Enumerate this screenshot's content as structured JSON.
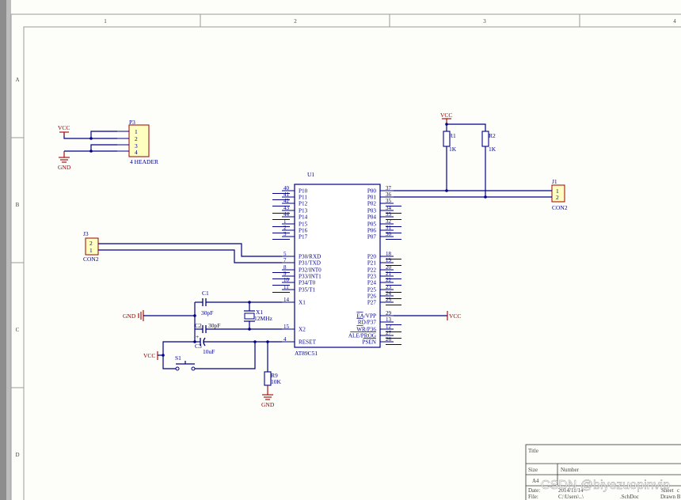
{
  "frame": {
    "columns": [
      "1",
      "2",
      "3",
      "4"
    ],
    "rows": [
      "A",
      "B",
      "C",
      "D"
    ]
  },
  "power": {
    "vcc": "VCC",
    "gnd": "GND"
  },
  "components": {
    "p3": {
      "designator": "P3",
      "value": "4 HEADER",
      "pins": [
        "1",
        "2",
        "3",
        "4"
      ]
    },
    "j1": {
      "designator": "J1",
      "value": "CON2",
      "pins": [
        "1",
        "2"
      ]
    },
    "j3": {
      "designator": "J3",
      "value": "CON2",
      "pins": [
        "2",
        "1"
      ]
    },
    "r1": {
      "designator": "R1",
      "value": "1K"
    },
    "r2": {
      "designator": "R2",
      "value": "1K"
    },
    "r9": {
      "designator": "R9",
      "value": "10K"
    },
    "c1": {
      "designator": "C1",
      "value": "30pF"
    },
    "c2": {
      "designator": "C2",
      "value": "30pF"
    },
    "c3": {
      "designator": "C3",
      "value": "10uF"
    },
    "x1": {
      "designator": "X1",
      "value": "12MHz"
    },
    "s1": {
      "designator": "S1"
    },
    "u1": {
      "designator": "U1",
      "value": "AT89C51",
      "left_pins": [
        {
          "num": "40",
          "name": "P10"
        },
        {
          "num": "41",
          "name": "P11"
        },
        {
          "num": "42",
          "name": "P12"
        },
        {
          "num": "43",
          "name": "P13"
        },
        {
          "num": "44",
          "name": "P14"
        },
        {
          "num": "1",
          "name": "P15"
        },
        {
          "num": "2",
          "name": "P16"
        },
        {
          "num": "3",
          "name": "P17"
        },
        {
          "num": "5",
          "name": "P30/RXD"
        },
        {
          "num": "7",
          "name": "P31/TXD"
        },
        {
          "num": "8",
          "name": "P32/INT0"
        },
        {
          "num": "9",
          "name": "P33/INT1"
        },
        {
          "num": "10",
          "name": "P34/T0"
        },
        {
          "num": "11",
          "name": "P35/T1"
        },
        {
          "num": "14",
          "name": "X1"
        },
        {
          "num": "15",
          "name": "X2"
        },
        {
          "num": "4",
          "name": "RESET"
        }
      ],
      "right_pins": [
        {
          "num": "37",
          "name": "P00"
        },
        {
          "num": "36",
          "name": "P01"
        },
        {
          "num": "35",
          "name": "P02"
        },
        {
          "num": "34",
          "name": "P03"
        },
        {
          "num": "33",
          "name": "P04"
        },
        {
          "num": "32",
          "name": "P05"
        },
        {
          "num": "31",
          "name": "P06"
        },
        {
          "num": "30",
          "name": "P07"
        },
        {
          "num": "18",
          "name": "P20"
        },
        {
          "num": "19",
          "name": "P21"
        },
        {
          "num": "20",
          "name": "P22"
        },
        {
          "num": "21",
          "name": "P23"
        },
        {
          "num": "22",
          "name": "P24"
        },
        {
          "num": "23",
          "name": "P25"
        },
        {
          "num": "24",
          "name": "P26"
        },
        {
          "num": "25",
          "name": "P27"
        },
        {
          "num": "29",
          "name": "EA/VPP"
        },
        {
          "num": "13",
          "name": "RD/P37"
        },
        {
          "num": "12",
          "name": "WR/P36"
        },
        {
          "num": "27",
          "name": "ALE/PROG"
        },
        {
          "num": "26",
          "name": "PSEN"
        }
      ]
    }
  },
  "title_block": {
    "title_label": "Title",
    "size_label": "Size",
    "number_label": "Number",
    "date_label": "Date:",
    "date_value": "2014/11/14",
    "file_label": "File:",
    "file_value": "C:\\Users\\..\\",
    "file_ext": ".SchDoc",
    "sheet_label": "Sheet",
    "sheet_value": "c",
    "drawn_label": "Drawn B",
    "partial": "A4"
  },
  "watermark": "CSDN @biyezuopinvip"
}
